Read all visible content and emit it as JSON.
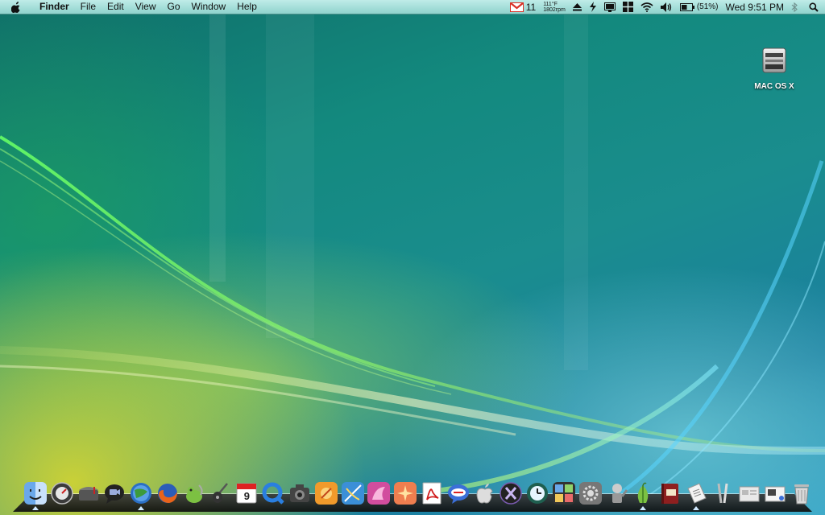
{
  "menubar": {
    "app_name": "Finder",
    "menus": [
      "File",
      "Edit",
      "View",
      "Go",
      "Window",
      "Help"
    ],
    "status": {
      "gmail_count": "11",
      "temperature": "111°F",
      "fan_speed": "1802rpm",
      "battery": "(51%)",
      "clock": "Wed 9:51 PM"
    }
  },
  "desktop": {
    "icons": [
      {
        "label": "MAC OS X",
        "icon": "hard-drive-icon"
      }
    ]
  },
  "dock": {
    "items": [
      {
        "name": "finder",
        "running": true
      },
      {
        "name": "dashboard",
        "running": false
      },
      {
        "name": "mail",
        "running": false
      },
      {
        "name": "ichat",
        "running": false
      },
      {
        "name": "safari",
        "running": true
      },
      {
        "name": "firefox",
        "running": false
      },
      {
        "name": "adium",
        "running": false
      },
      {
        "name": "garageband",
        "running": false
      },
      {
        "name": "ical",
        "running": false,
        "date": "9"
      },
      {
        "name": "quicktime",
        "running": false
      },
      {
        "name": "image-capture",
        "running": false
      },
      {
        "name": "photoshop",
        "running": false
      },
      {
        "name": "illustrator",
        "running": false
      },
      {
        "name": "indesign",
        "running": false
      },
      {
        "name": "fireworks",
        "running": false
      },
      {
        "name": "acrobat",
        "running": false
      },
      {
        "name": "comic-life",
        "running": false
      },
      {
        "name": "apple-support",
        "running": false
      },
      {
        "name": "x11",
        "running": false
      },
      {
        "name": "time-machine",
        "running": false
      },
      {
        "name": "spaces",
        "running": false
      },
      {
        "name": "system-preferences",
        "running": false
      },
      {
        "name": "automator",
        "running": false
      },
      {
        "name": "onion-app",
        "running": true
      },
      {
        "name": "dictionary",
        "running": false
      },
      {
        "name": "script-editor",
        "running": true
      },
      {
        "name": "utilities-folder",
        "running": false
      },
      {
        "name": "documents-stack",
        "running": false
      },
      {
        "name": "downloads-stack",
        "running": false
      },
      {
        "name": "trash",
        "running": false
      }
    ]
  },
  "colors": {
    "menubar_top": "#bfece8",
    "menubar_bottom": "#8fd3cd",
    "dock_shelf": "#0c0c0c",
    "gmail_red": "#d93025"
  }
}
